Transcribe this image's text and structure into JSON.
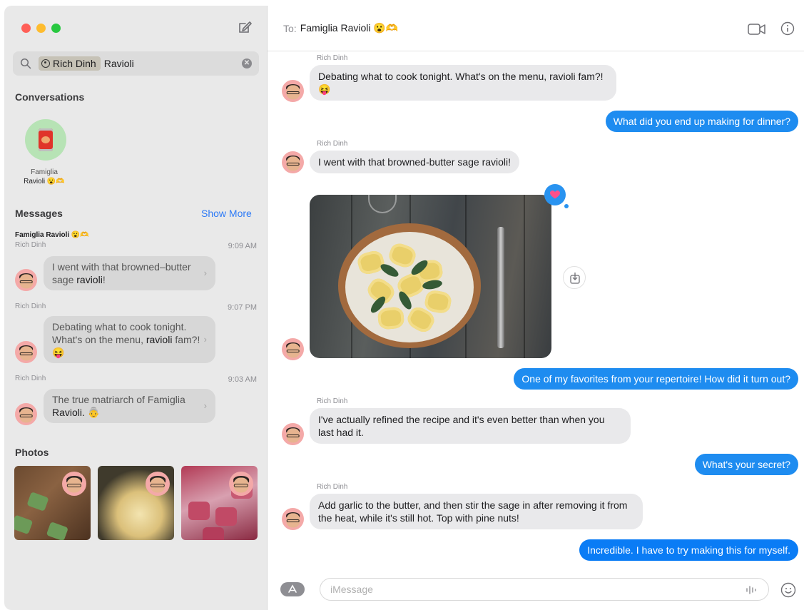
{
  "sidebar": {
    "search": {
      "token": "Rich Dinh",
      "query": "Ravioli"
    },
    "conversations_title": "Conversations",
    "conversation": {
      "name_line1": "Famiglia",
      "name_line2": "Ravioli 😮🫶"
    },
    "messages_title": "Messages",
    "show_more": "Show More",
    "results": [
      {
        "group": "Famiglia Ravioli 😮🫶",
        "sender": "Rich Dinh",
        "time": "9:09 AM",
        "text_before": "I went with that browned–butter sage ",
        "text_match": "ravioli",
        "text_after": "!"
      },
      {
        "sender": "Rich Dinh",
        "time": "9:07 PM",
        "text_before": "Debating what to cook tonight. What's on the menu, ",
        "text_match": "ravioli",
        "text_after": " fam?! 😝"
      },
      {
        "sender": "Rich Dinh",
        "time": "9:03 AM",
        "text_before": "The true matriarch of Famiglia ",
        "text_match": "Ravioli.",
        "text_after": " 👵"
      }
    ],
    "photos_title": "Photos"
  },
  "chat": {
    "to_label": "To:",
    "recipient": "Famiglia Ravioli 😮🫶",
    "messages": [
      {
        "from": "them",
        "sender": "Rich Dinh",
        "text": "Debating what to cook tonight. What's on the menu, ravioli fam?! 😝"
      },
      {
        "from": "me",
        "text": "What did you end up making for dinner?"
      },
      {
        "from": "them",
        "sender": "Rich Dinh",
        "text": "I went with that browned-butter sage ravioli!"
      },
      {
        "from": "them",
        "type": "photo",
        "reaction": "heart"
      },
      {
        "from": "me",
        "text": "One of my favorites from your repertoire! How did it turn out?"
      },
      {
        "from": "them",
        "sender": "Rich Dinh",
        "text": "I've actually refined the recipe and it's even better than when you last had it."
      },
      {
        "from": "me",
        "text": "What's your secret?"
      },
      {
        "from": "them",
        "sender": "Rich Dinh",
        "text": "Add garlic to the butter, and then stir the sage in after removing it from the heat, while it's still hot. Top with pine nuts!"
      },
      {
        "from": "me",
        "text": "Incredible. I have to try making this for myself."
      }
    ],
    "composer_placeholder": "iMessage"
  },
  "colors": {
    "accent": "#1e8cf0",
    "incoming_bubble": "#e9e9eb",
    "sidebar_bg": "#e9e9e9"
  },
  "icons": [
    "compose-icon",
    "search-icon",
    "clear-icon",
    "video-icon",
    "info-icon",
    "heart-icon",
    "save-icon",
    "app-store-icon",
    "waveform-icon",
    "emoji-icon"
  ]
}
